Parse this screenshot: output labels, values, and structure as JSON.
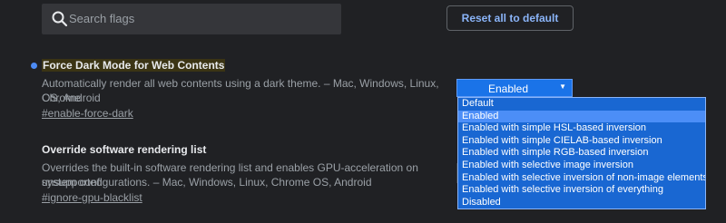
{
  "search": {
    "placeholder": "Search flags",
    "icon": "search-icon"
  },
  "reset_button": {
    "label": "Reset all to default"
  },
  "flags": [
    {
      "title": "Force Dark Mode for Web Contents",
      "modified": true,
      "description_line1": "Automatically render all web contents using a dark theme. – Mac, Windows, Linux, Chrome",
      "description_line2": "OS, Android",
      "link": "#enable-force-dark",
      "selected_value": "Enabled",
      "options": [
        "Default",
        "Enabled",
        "Enabled with simple HSL-based inversion",
        "Enabled with simple CIELAB-based inversion",
        "Enabled with simple RGB-based inversion",
        "Enabled with selective image inversion",
        "Enabled with selective inversion of non-image elements",
        "Enabled with selective inversion of everything",
        "Disabled"
      ],
      "highlighted_option_index": 1
    },
    {
      "title": "Override software rendering list",
      "modified": false,
      "description_line1": "Overrides the built-in software rendering list and enables GPU-acceleration on unsupported",
      "description_line2": "system configurations. – Mac, Windows, Linux, Chrome OS, Android",
      "link": "#ignore-gpu-blacklist"
    }
  ],
  "colors": {
    "background": "#202124",
    "accent": "#8ab4f8",
    "modified_dot": "#4c8bf5",
    "dropdown_bg": "#1967d2",
    "dropdown_selected": "#4c8ef7"
  }
}
